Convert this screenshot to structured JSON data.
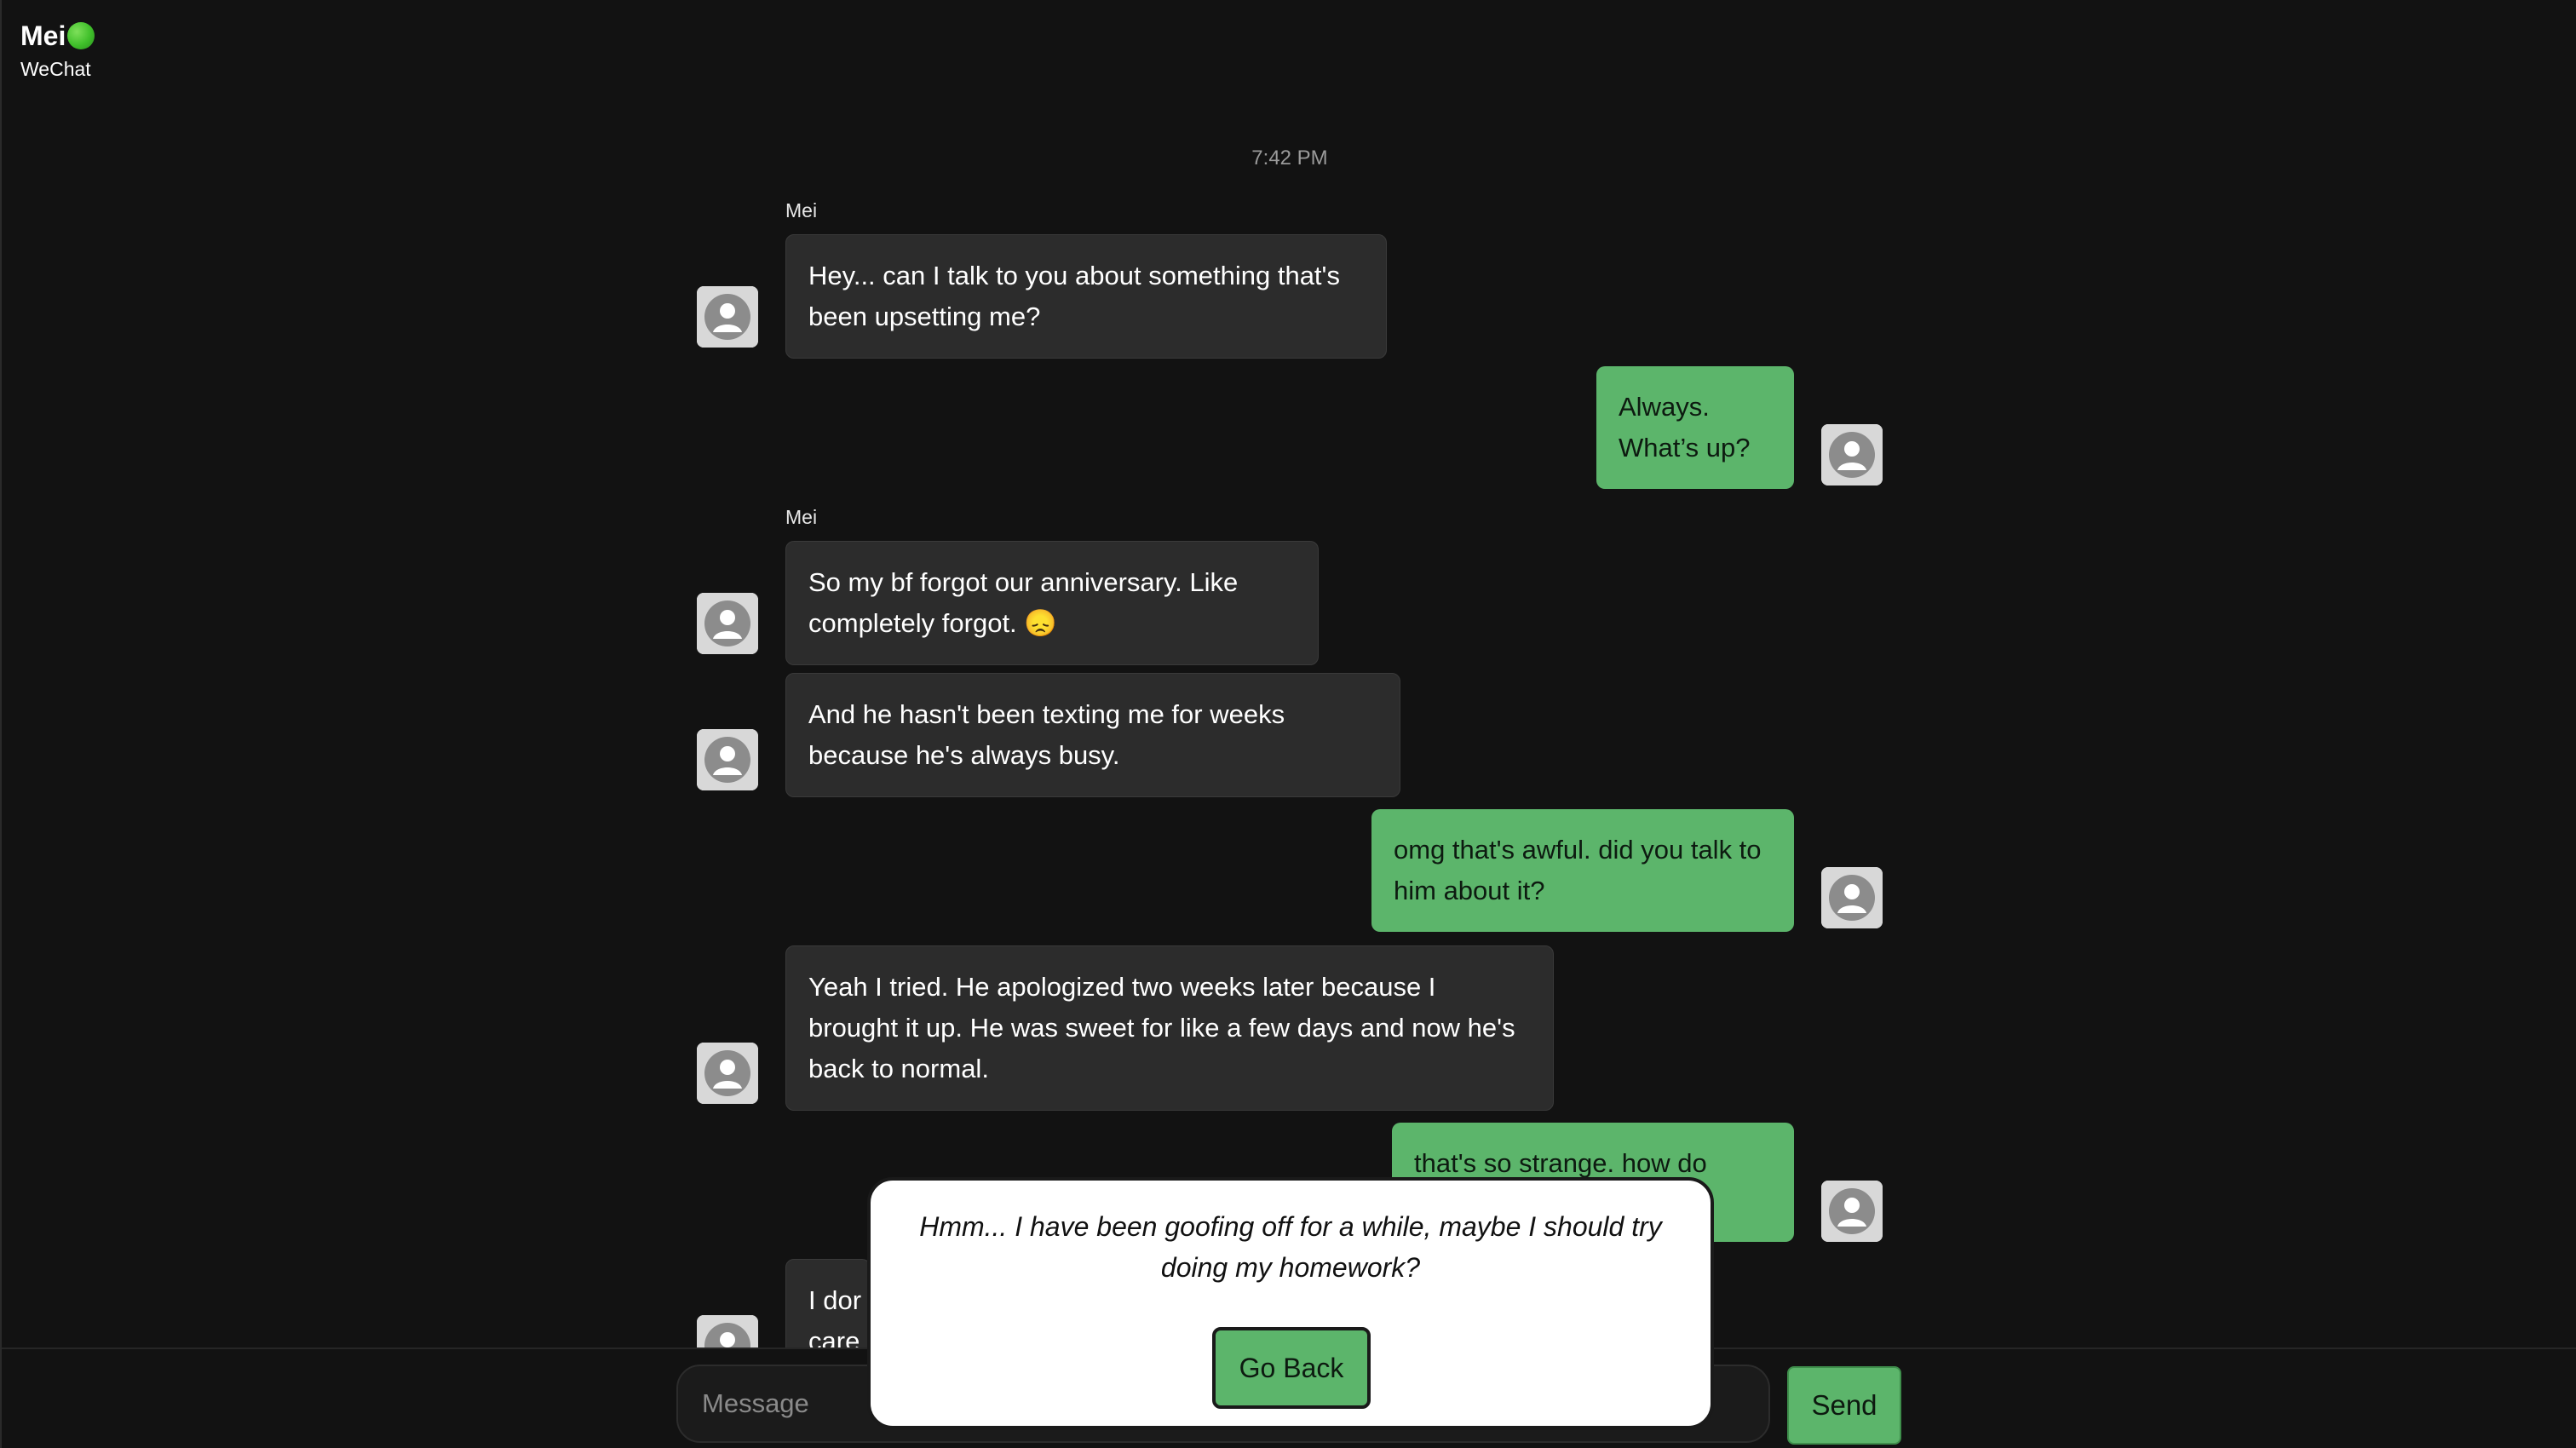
{
  "header": {
    "contact_name": "Mei",
    "status_icon": "green-circle-icon",
    "app_label": "WeChat"
  },
  "chat": {
    "timestamp": "7:42 PM",
    "messages": [
      {
        "from": "Mei",
        "direction": "in",
        "show_sender": true,
        "text": "Hey... can I talk to you about something that's been upsetting me?"
      },
      {
        "from": "me",
        "direction": "out",
        "text": "Always. What’s up?"
      },
      {
        "from": "Mei",
        "direction": "in",
        "show_sender": true,
        "text": "So my bf forgot our anniversary. Like completely forgot. 😞"
      },
      {
        "from": "Mei",
        "direction": "in",
        "show_sender": false,
        "text": "And he hasn't been texting me for weeks because he's always busy."
      },
      {
        "from": "me",
        "direction": "out",
        "text": "omg that's awful. did you talk to him about it?"
      },
      {
        "from": "Mei",
        "direction": "in",
        "show_sender": false,
        "text": "Yeah I tried. He apologized two weeks later because I brought it up. He was sweet for like a few days and now he's back to normal."
      },
      {
        "from": "me",
        "direction": "out",
        "text": "that's so strange. how do"
      },
      {
        "from": "Mei",
        "direction": "in",
        "show_sender": false,
        "text": "I dor care"
      }
    ]
  },
  "composer": {
    "placeholder": "Message",
    "send_label": "Send"
  },
  "overlay": {
    "text": "Hmm... I have been goofing off for a while, maybe I should try doing my homework?",
    "button_label": "Go Back"
  },
  "colors": {
    "background": "#121212",
    "incoming_bubble": "#2c2c2c",
    "outgoing_bubble": "#5cb56b",
    "status_dot": "#3fbf2a"
  }
}
